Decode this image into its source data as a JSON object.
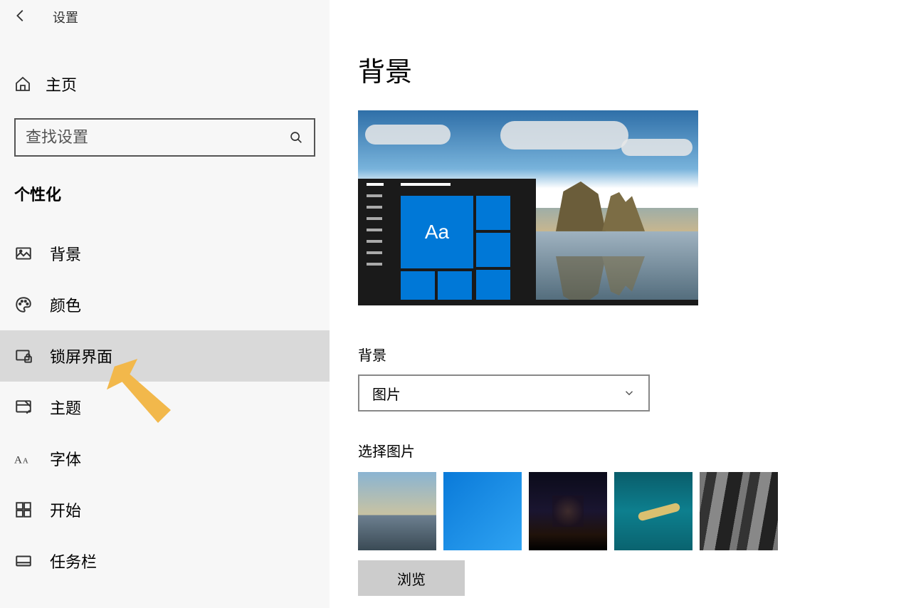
{
  "app_title": "设置",
  "home_label": "主页",
  "search_placeholder": "查找设置",
  "sidebar_section": "个性化",
  "nav": [
    {
      "key": "background",
      "label": "背景"
    },
    {
      "key": "color",
      "label": "颜色"
    },
    {
      "key": "lockscreen",
      "label": "锁屏界面",
      "selected": true
    },
    {
      "key": "theme",
      "label": "主题"
    },
    {
      "key": "font",
      "label": "字体"
    },
    {
      "key": "start",
      "label": "开始"
    },
    {
      "key": "taskbar",
      "label": "任务栏"
    }
  ],
  "content": {
    "page_title": "背景",
    "preview_tile_text": "Aa",
    "background_field_label": "背景",
    "background_dropdown_value": "图片",
    "choose_image_label": "选择图片",
    "browse_button": "浏览"
  }
}
